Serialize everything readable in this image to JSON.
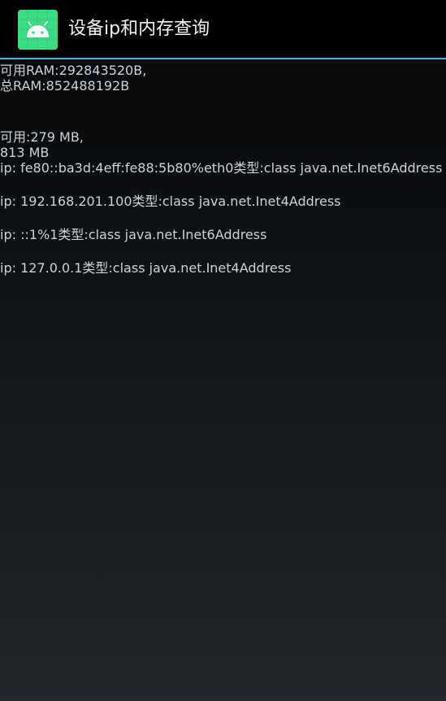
{
  "app": {
    "title": "设备ip和内存查询",
    "icon": "android-robot-icon",
    "accent_color": "#33b5e5",
    "icon_bg_color": "#3ddc84"
  },
  "ram": {
    "available": "可用RAM:292843520B,",
    "total": "总RAM:852488192B"
  },
  "memory": {
    "available": "可用:279 MB,",
    "total": "813 MB"
  },
  "ip_list": [
    "ip: fe80::ba3d:4eff:fe88:5b80%eth0类型:class java.net.Inet6Address",
    "ip: 192.168.201.100类型:class java.net.Inet4Address",
    "ip: ::1%1类型:class java.net.Inet6Address",
    "ip: 127.0.0.1类型:class java.net.Inet4Address"
  ]
}
